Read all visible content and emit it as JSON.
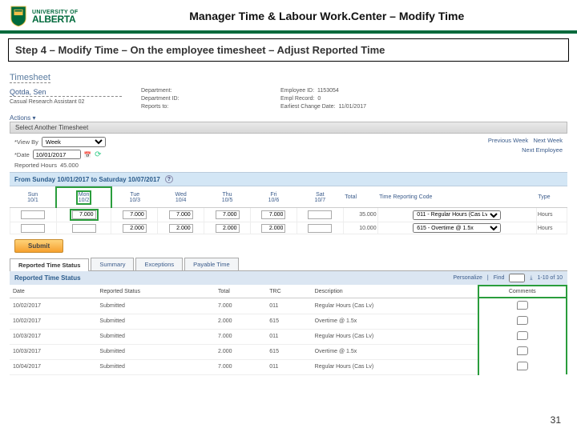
{
  "logo": {
    "line1": "UNIVERSITY OF",
    "line2": "ALBERTA"
  },
  "page_title": "Manager Time & Labour Work.Center – Modify Time",
  "step_title": "Step 4 – Modify Time – On the employee timesheet – Adjust Reported Time",
  "ts_heading": "Timesheet",
  "employee": {
    "name": "Qotda, Sen",
    "role": "Casual Research Assistant 02",
    "department_lbl": "Department:",
    "department_id_lbl": "Department ID:",
    "reports_to_lbl": "Reports to:",
    "empid_lbl": "Employee ID:",
    "empid_val": "1153054",
    "empl_record_lbl": "Empl Record:",
    "empl_record_val": "0",
    "earliest_lbl": "Earliest Change Date:",
    "earliest_val": "11/01/2017"
  },
  "actions": "Actions ▾",
  "select_bar": "Select Another Timesheet",
  "viewby": {
    "label": "*View By",
    "value": "Week",
    "date_label": "*Date",
    "date_value": "10/01/2017",
    "reported_label": "Reported Hours",
    "reported_value": "45.000"
  },
  "nav": {
    "prev": "Previous Week",
    "next": "Next Week",
    "next_emp": "Next Employee"
  },
  "range": "From Sunday 10/01/2017 to Saturday 10/07/2017",
  "days": {
    "headers": [
      {
        "d": "Sun",
        "n": "10/1"
      },
      {
        "d": "Mon",
        "n": "10/2"
      },
      {
        "d": "Tue",
        "n": "10/3"
      },
      {
        "d": "Wed",
        "n": "10/4"
      },
      {
        "d": "Thu",
        "n": "10/5"
      },
      {
        "d": "Fri",
        "n": "10/6"
      },
      {
        "d": "Sat",
        "n": "10/7"
      }
    ],
    "total_hdr": "Total",
    "trc_hdr": "Time Reporting Code",
    "type_hdr": "Type",
    "rows": [
      {
        "vals": [
          "",
          "7.000",
          "7.000",
          "7.000",
          "7.000",
          "7.000",
          ""
        ],
        "total": "35.000",
        "trc": "011 - Regular Hours (Cas Lv)",
        "type": "Hours"
      },
      {
        "vals": [
          "",
          "",
          "2.000",
          "2.000",
          "2.000",
          "2.000",
          ""
        ],
        "total": "10.000",
        "trc": "615 - Overtime @ 1.5x",
        "type": "Hours"
      }
    ]
  },
  "submit_label": "Submit",
  "tabs": [
    "Reported Time Status",
    "Summary",
    "Exceptions",
    "Payable Time"
  ],
  "status_section": "Reported Time Status",
  "tools": {
    "personalize": "Personalize",
    "find": "Find",
    "count": "1-10 of 10"
  },
  "status_cols": [
    "Date",
    "Reported Status",
    "Total",
    "TRC",
    "Description",
    "Comments"
  ],
  "status_rows": [
    {
      "date": "10/02/2017",
      "status": "Submitted",
      "total": "7.000",
      "trc": "011",
      "desc": "Regular Hours (Cas Lv)"
    },
    {
      "date": "10/02/2017",
      "status": "Submitted",
      "total": "2.000",
      "trc": "615",
      "desc": "Overtime @ 1.5x"
    },
    {
      "date": "10/03/2017",
      "status": "Submitted",
      "total": "7.000",
      "trc": "011",
      "desc": "Regular Hours (Cas Lv)"
    },
    {
      "date": "10/03/2017",
      "status": "Submitted",
      "total": "2.000",
      "trc": "615",
      "desc": "Overtime @ 1.5x"
    },
    {
      "date": "10/04/2017",
      "status": "Submitted",
      "total": "7.000",
      "trc": "011",
      "desc": "Regular Hours (Cas Lv)"
    }
  ],
  "page_number": "31"
}
